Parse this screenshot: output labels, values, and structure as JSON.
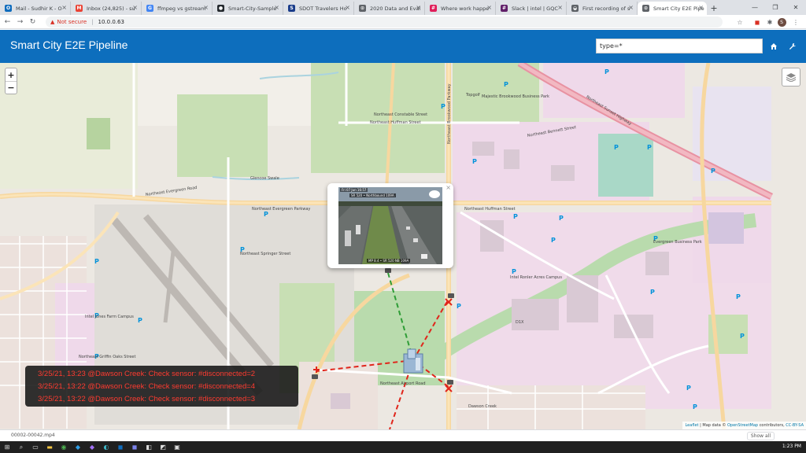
{
  "browser": {
    "tabs": [
      {
        "title": "Mail - Sudhir K - O",
        "icon_color": "#0f6cbd",
        "icon_label": "O"
      },
      {
        "title": "Inbox (24,825) - su",
        "icon_color": "#ea4335",
        "icon_label": "M"
      },
      {
        "title": "ffmpeg vs gstream",
        "icon_color": "#4285f4",
        "icon_label": "G"
      },
      {
        "title": "Smart-City-Sample",
        "icon_color": "#24292e",
        "icon_label": "●"
      },
      {
        "title": "SDOT Travelers Ho",
        "icon_color": "#1a3c8a",
        "icon_label": "S"
      },
      {
        "title": "2020 Data and Eval",
        "icon_color": "#5f6368",
        "icon_label": "⊙"
      },
      {
        "title": "Where work happe",
        "icon_color": "#e01e5a",
        "icon_label": "#"
      },
      {
        "title": "Slack | intel | GQC",
        "icon_color": "#611f69",
        "icon_label": "#"
      },
      {
        "title": "First recording of s",
        "icon_color": "#5f6368",
        "icon_label": "◒"
      },
      {
        "title": "Smart City E2E Pipe",
        "icon_color": "#5f6368",
        "icon_label": "⊙",
        "active": true
      }
    ],
    "new_tab": "+",
    "security_label": "Not secure",
    "url": "10.0.0.63",
    "profile_initial": "S"
  },
  "app": {
    "title": "Smart City E2E Pipeline",
    "search_value": "type=*"
  },
  "map": {
    "zoom_in": "+",
    "zoom_out": "−",
    "labels": [
      {
        "text": "Northeast Evergreen Road"
      },
      {
        "text": "Northeast Evergreen Parkway"
      },
      {
        "text": "Northeast Huffman Street"
      },
      {
        "text": "Northeast Huffman Street"
      },
      {
        "text": "Northeast Constable Street"
      },
      {
        "text": "Northeast Sunset Highway"
      },
      {
        "text": "Majestic Brookwood Business Park"
      },
      {
        "text": "Intel Ronler Acres Campus"
      },
      {
        "text": "Intel Jones Farm Campus"
      },
      {
        "text": "Northeast Griffin Oaks Street"
      },
      {
        "text": "Northeast Airport Road"
      },
      {
        "text": "Northeast Brookwood Parkway"
      },
      {
        "text": "Dawson Creek"
      },
      {
        "text": "Evergreen Business Park"
      },
      {
        "text": "Northeast Springer Street"
      },
      {
        "text": "Northeast Bennett Street"
      },
      {
        "text": "Glencoe Swale"
      },
      {
        "text": "D1X"
      },
      {
        "text": "Topgolf"
      }
    ],
    "popup": {
      "timestamp": "Fri 07 Jun 16:57",
      "caption_top": "SR 520 • Northbound 109A",
      "caption_bottom": "MP 8.4 • SR 520 NB 109A",
      "close": "×"
    },
    "alerts": [
      "3/25/21, 13:23 @Dawson Creek: Check sensor: #disconnected=2",
      "3/25/21, 13:22 @Dawson Creek: Check sensor: #disconnected=4",
      "3/25/21, 13:22 @Dawson Creek: Check sensor: #disconnected=3"
    ],
    "attribution": {
      "leaflet": "Leaflet",
      "map_data": "| Map data ©",
      "osm": "OpenStreetMap",
      "contributors": "contributors,",
      "license": "CC-BY-SA"
    }
  },
  "downloads": {
    "file": "00002-00042.mp4",
    "show_all": "Show all"
  },
  "taskbar": {
    "clock": "1:23 PM"
  }
}
